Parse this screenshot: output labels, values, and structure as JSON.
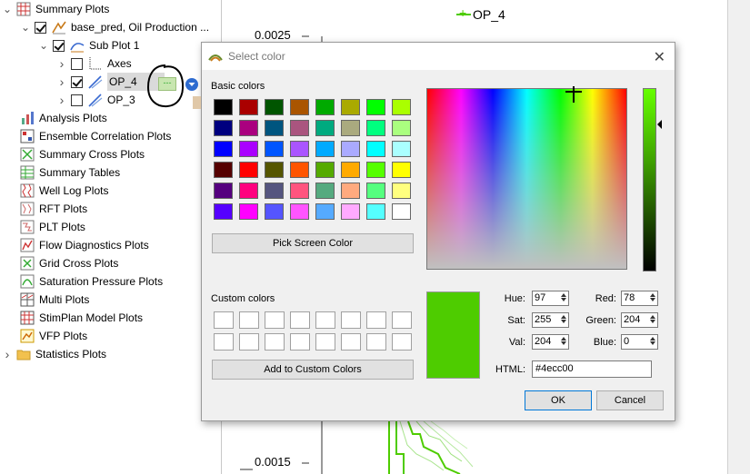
{
  "tree": {
    "items": [
      {
        "label": "Summary Plots",
        "icon": "summary-plots-icon",
        "expander": "down",
        "checkbox": false,
        "indent": 0
      },
      {
        "label": "base_pred, Oil Production ...",
        "icon": "curve-case-icon",
        "expander": "down",
        "checkbox": true,
        "indent": 1
      },
      {
        "label": "Sub Plot 1",
        "icon": "subplot-icon",
        "expander": "down",
        "checkbox": true,
        "indent": 2
      },
      {
        "label": "Axes",
        "icon": "axes-icon",
        "expander": "right",
        "checkbox": false,
        "indent": 3
      },
      {
        "label": "OP_4",
        "icon": "curve-icon",
        "expander": "right",
        "checkbox": true,
        "indent": 3
      },
      {
        "label": "OP_3",
        "icon": "curve-icon",
        "expander": "right",
        "checkbox": false,
        "indent": 3
      },
      {
        "label": "Analysis Plots",
        "icon": "analysis-plots-icon",
        "indent": 0
      },
      {
        "label": "Ensemble Correlation Plots",
        "icon": "correlation-plots-icon",
        "indent": 0
      },
      {
        "label": "Summary Cross Plots",
        "icon": "cross-plots-icon",
        "indent": 0
      },
      {
        "label": "Summary Tables",
        "icon": "summary-tables-icon",
        "indent": 0
      },
      {
        "label": "Well Log Plots",
        "icon": "well-log-plots-icon",
        "indent": 0
      },
      {
        "label": "RFT Plots",
        "icon": "rft-plots-icon",
        "indent": 0
      },
      {
        "label": "PLT Plots",
        "icon": "plt-plots-icon",
        "indent": 0
      },
      {
        "label": "Flow Diagnostics Plots",
        "icon": "flow-diagnostics-icon",
        "indent": 0
      },
      {
        "label": "Grid Cross Plots",
        "icon": "grid-cross-plots-icon",
        "indent": 0
      },
      {
        "label": "Saturation Pressure Plots",
        "icon": "saturation-pressure-icon",
        "indent": 0
      },
      {
        "label": "Multi Plots",
        "icon": "multi-plots-icon",
        "indent": 0
      },
      {
        "label": "StimPlan Model Plots",
        "icon": "stimplan-plots-icon",
        "indent": 0
      },
      {
        "label": "VFP Plots",
        "icon": "vfp-plots-icon",
        "indent": 0
      },
      {
        "label": "Statistics Plots",
        "icon": "folder-icon",
        "expander": "right",
        "indent": 0
      }
    ]
  },
  "plot": {
    "legend": "OP_4",
    "y_top": "0.0025",
    "y_bottom": "0.0015"
  },
  "dialog": {
    "title": "Select color",
    "basic_colors_label": "Basic colors",
    "basic_colors": [
      [
        "#000000",
        "#aa0000",
        "#005500",
        "#aa5500",
        "#00aa00",
        "#aaaa00",
        "#00ff00",
        "#aaff00"
      ],
      [
        "#00007f",
        "#aa007f",
        "#00557f",
        "#aa557f",
        "#00aa7f",
        "#aaaa7f",
        "#00ff7f",
        "#aaff7f"
      ],
      [
        "#0000ff",
        "#aa00ff",
        "#0055ff",
        "#aa55ff",
        "#00aaff",
        "#aaaaff",
        "#00ffff",
        "#aaffff"
      ],
      [
        "#550000",
        "#ff0000",
        "#555500",
        "#ff5500",
        "#55aa00",
        "#ffaa00",
        "#55ff00",
        "#ffff00"
      ],
      [
        "#55007f",
        "#ff007f",
        "#55557f",
        "#ff557f",
        "#55aa7f",
        "#ffaa7f",
        "#55ff7f",
        "#ffff7f"
      ],
      [
        "#5500ff",
        "#ff00ff",
        "#5555ff",
        "#ff55ff",
        "#55aaff",
        "#ffaaff",
        "#55ffff",
        "#ffffff"
      ]
    ],
    "pick_screen_label": "Pick Screen Color",
    "custom_colors_label": "Custom colors",
    "add_custom_label": "Add to Custom Colors",
    "current_color": "#4ecc00",
    "fields": {
      "hue_label": "Hue:",
      "hue": "97",
      "sat_label": "Sat:",
      "sat": "255",
      "val_label": "Val:",
      "val": "204",
      "red_label": "Red:",
      "red": "78",
      "green_label": "Green:",
      "green": "204",
      "blue_label": "Blue:",
      "blue": "0",
      "html_label": "HTML:",
      "html": "#4ecc00"
    },
    "ok_label": "OK",
    "cancel_label": "Cancel"
  }
}
